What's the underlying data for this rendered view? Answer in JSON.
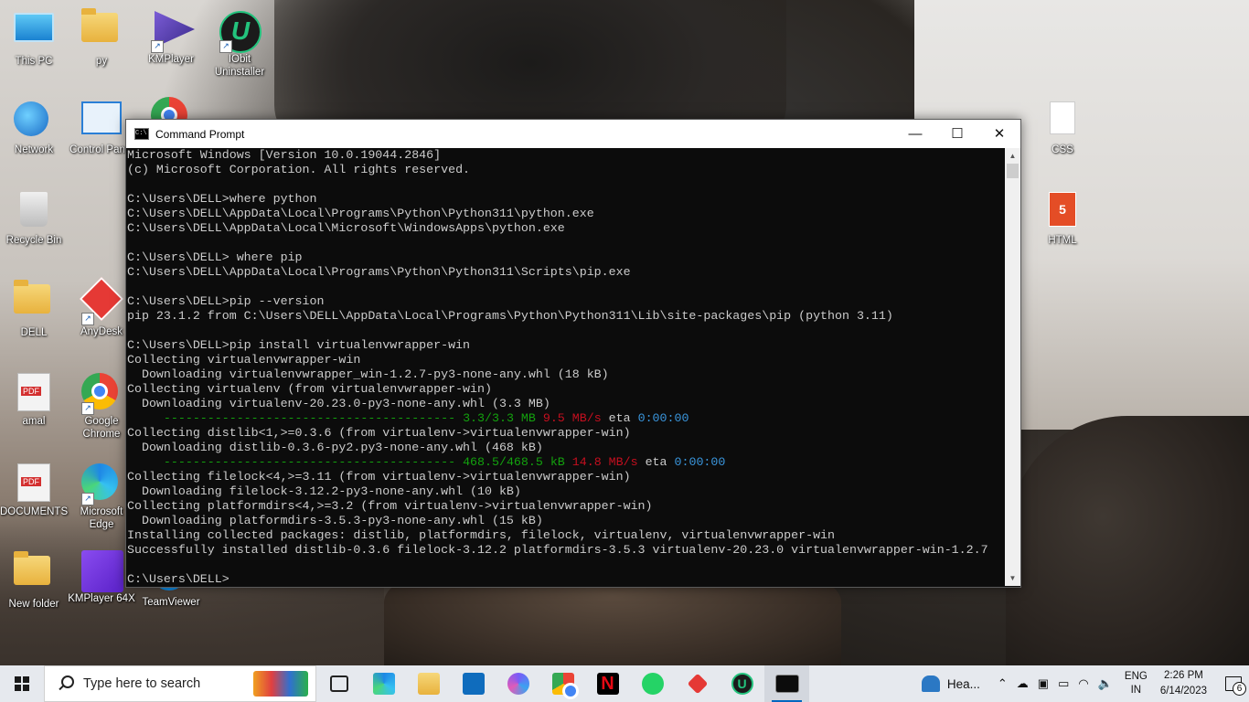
{
  "desktop": {
    "icons": [
      {
        "id": "this-pc",
        "label": "This PC"
      },
      {
        "id": "py",
        "label": "py"
      },
      {
        "id": "kmplayer",
        "label": "KMPlayer"
      },
      {
        "id": "iobit",
        "label": "IObit Uninstaller"
      },
      {
        "id": "network",
        "label": "Network"
      },
      {
        "id": "control-panel",
        "label": "Control Panel"
      },
      {
        "id": "recycle-bin",
        "label": "Recycle Bin"
      },
      {
        "id": "dell",
        "label": "DELL"
      },
      {
        "id": "anydesk",
        "label": "AnyDesk"
      },
      {
        "id": "amal",
        "label": "amal"
      },
      {
        "id": "google-chrome",
        "label": "Google Chrome"
      },
      {
        "id": "documents",
        "label": "DOCUMENTS"
      },
      {
        "id": "microsoft-edge",
        "label": "Microsoft Edge"
      },
      {
        "id": "new-folder",
        "label": "New folder"
      },
      {
        "id": "kmplayer-64x",
        "label": "KMPlayer 64X"
      },
      {
        "id": "teamviewer",
        "label": "TeamViewer"
      },
      {
        "id": "css",
        "label": "CSS"
      },
      {
        "id": "html",
        "label": "HTML"
      }
    ]
  },
  "cmd_window": {
    "title": "Command Prompt",
    "controls": {
      "minimize": "—",
      "maximize": "☐",
      "close": "✕"
    },
    "lines": [
      {
        "t": "Microsoft Windows [Version 10.0.19044.2846]"
      },
      {
        "t": "(c) Microsoft Corporation. All rights reserved."
      },
      {
        "t": ""
      },
      {
        "t": "C:\\Users\\DELL>where python"
      },
      {
        "t": "C:\\Users\\DELL\\AppData\\Local\\Programs\\Python\\Python311\\python.exe"
      },
      {
        "t": "C:\\Users\\DELL\\AppData\\Local\\Microsoft\\WindowsApps\\python.exe"
      },
      {
        "t": ""
      },
      {
        "t": "C:\\Users\\DELL> where pip"
      },
      {
        "t": "C:\\Users\\DELL\\AppData\\Local\\Programs\\Python\\Python311\\Scripts\\pip.exe"
      },
      {
        "t": ""
      },
      {
        "t": "C:\\Users\\DELL>pip --version"
      },
      {
        "t": "pip 23.1.2 from C:\\Users\\DELL\\AppData\\Local\\Programs\\Python\\Python311\\Lib\\site-packages\\pip (python 3.11)"
      },
      {
        "t": ""
      },
      {
        "t": "C:\\Users\\DELL>pip install virtualenvwrapper-win"
      },
      {
        "t": "Collecting virtualenvwrapper-win"
      },
      {
        "t": "  Downloading virtualenvwrapper_win-1.2.7-py3-none-any.whl (18 kB)"
      },
      {
        "t": "Collecting virtualenv (from virtualenvwrapper-win)"
      },
      {
        "t": "  Downloading virtualenv-20.23.0-py3-none-any.whl (3.3 MB)"
      },
      {
        "progress": true,
        "bar": "     ---------------------------------------- ",
        "size": "3.3/3.3 MB",
        "speed": "9.5 MB/s",
        "eta_label": "eta",
        "eta": "0:00:00"
      },
      {
        "t": "Collecting distlib<1,>=0.3.6 (from virtualenv->virtualenvwrapper-win)"
      },
      {
        "t": "  Downloading distlib-0.3.6-py2.py3-none-any.whl (468 kB)"
      },
      {
        "progress": true,
        "bar": "     ---------------------------------------- ",
        "size": "468.5/468.5 kB",
        "speed": "14.8 MB/s",
        "eta_label": "eta",
        "eta": "0:00:00"
      },
      {
        "t": "Collecting filelock<4,>=3.11 (from virtualenv->virtualenvwrapper-win)"
      },
      {
        "t": "  Downloading filelock-3.12.2-py3-none-any.whl (10 kB)"
      },
      {
        "t": "Collecting platformdirs<4,>=3.2 (from virtualenv->virtualenvwrapper-win)"
      },
      {
        "t": "  Downloading platformdirs-3.5.3-py3-none-any.whl (15 kB)"
      },
      {
        "t": "Installing collected packages: distlib, platformdirs, filelock, virtualenv, virtualenvwrapper-win"
      },
      {
        "t": "Successfully installed distlib-0.3.6 filelock-3.12.2 platformdirs-3.5.3 virtualenv-20.23.0 virtualenvwrapper-win-1.2.7"
      },
      {
        "t": ""
      },
      {
        "t": "C:\\Users\\DELL>"
      }
    ]
  },
  "taskbar": {
    "search_placeholder": "Type here to search",
    "apps": [
      "task-view",
      "microsoft-edge",
      "file-explorer",
      "mail",
      "copilot",
      "google-chrome",
      "netflix",
      "whatsapp",
      "anydesk",
      "iobit",
      "command-prompt"
    ],
    "weather": "Hea...",
    "language": {
      "line1": "ENG",
      "line2": "IN"
    },
    "time": "2:26 PM",
    "date": "6/14/2023",
    "notification_count": "6"
  },
  "colors": {
    "console_bg": "#0c0c0c",
    "console_text": "#cccccc",
    "progress_green": "#13a10e",
    "progress_red": "#c50f1f",
    "progress_blue": "#3a96dd",
    "taskbar_bg": "#e6e9ee"
  }
}
